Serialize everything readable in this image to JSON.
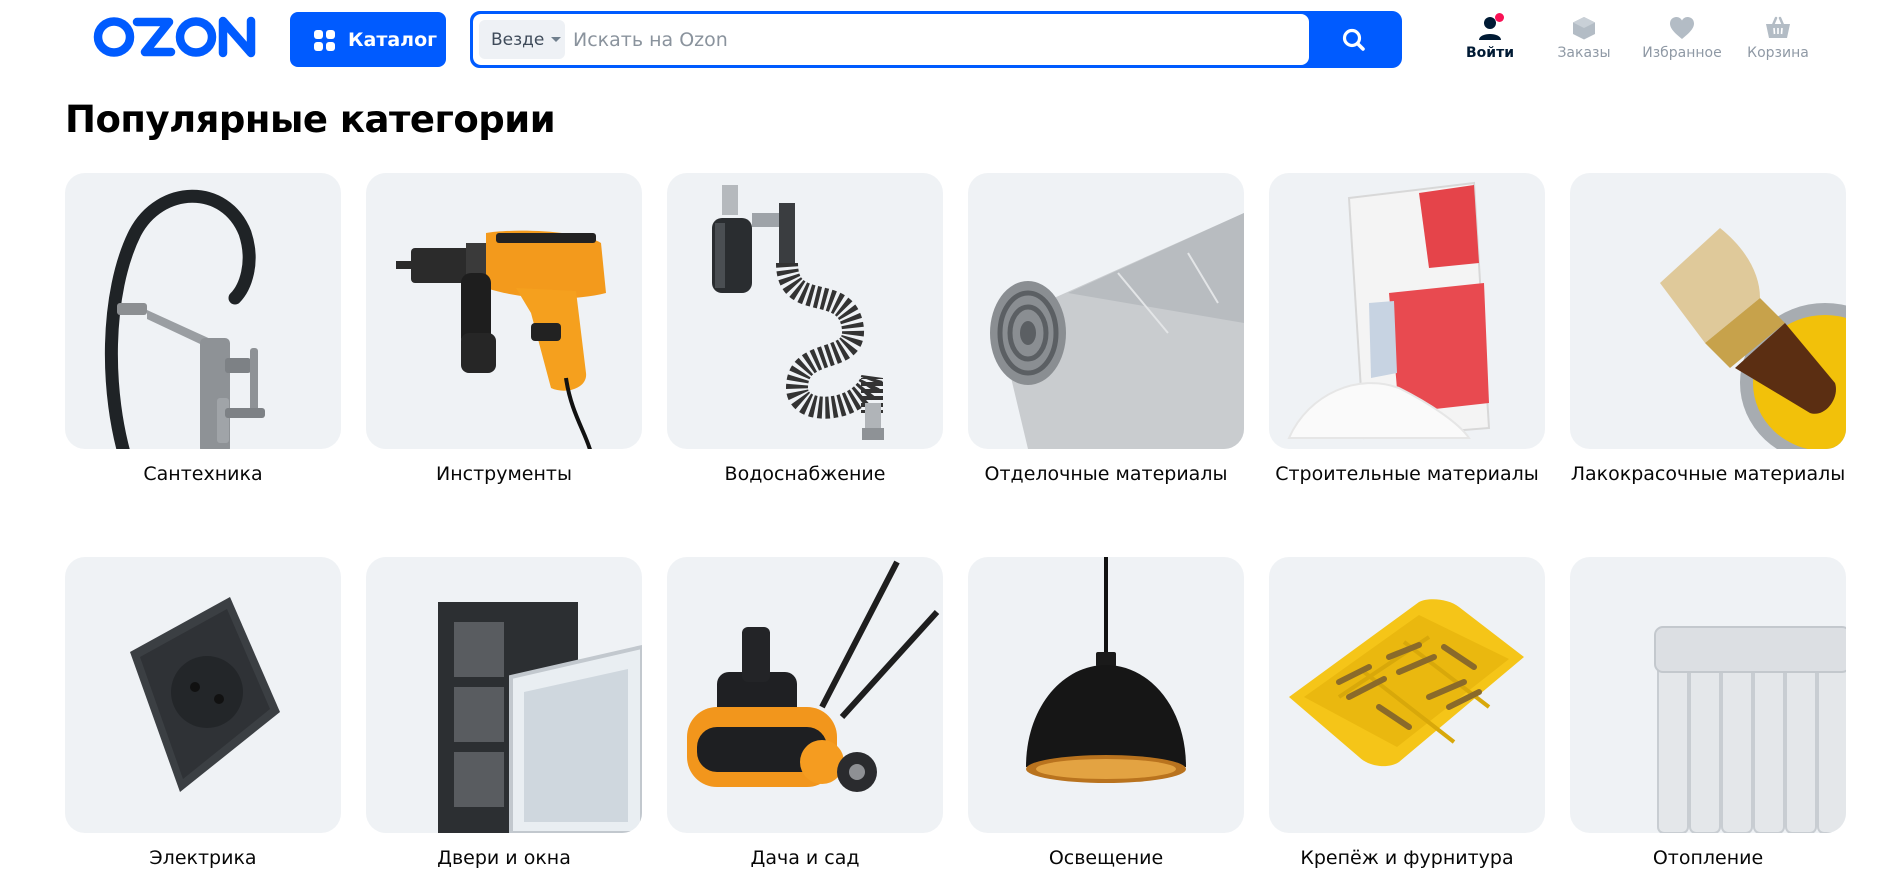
{
  "header": {
    "logo_text": "OZON",
    "catalog_label": "Каталог",
    "search": {
      "scope_label": "Везде",
      "placeholder": "Искать на Ozon"
    },
    "nav": {
      "login": "Войти",
      "orders": "Заказы",
      "favorites": "Избранное",
      "cart": "Корзина"
    }
  },
  "colors": {
    "brand_blue": "#005bff",
    "notification_dot": "#f91155",
    "tile_background": "#eff2f5"
  },
  "section": {
    "title": "Популярные категории"
  },
  "categories": [
    {
      "label": "Сантехника",
      "icon": "faucet-image"
    },
    {
      "label": "Инструменты",
      "icon": "drill-image"
    },
    {
      "label": "Водоснабжение",
      "icon": "siphon-image"
    },
    {
      "label": "Отделочные материалы",
      "icon": "linoleum-roll-image"
    },
    {
      "label": "Строительные материалы",
      "icon": "cement-bag-image"
    },
    {
      "label": "Лакокрасочные материалы",
      "icon": "paint-brush-image"
    },
    {
      "label": "Электрика",
      "icon": "socket-image"
    },
    {
      "label": "Двери и окна",
      "icon": "door-window-image"
    },
    {
      "label": "Дача и сад",
      "icon": "snow-blower-image"
    },
    {
      "label": "Освещение",
      "icon": "pendant-lamp-image"
    },
    {
      "label": "Крепёж и фурнитура",
      "icon": "screws-box-image"
    },
    {
      "label": "Отопление",
      "icon": "radiator-image"
    }
  ]
}
